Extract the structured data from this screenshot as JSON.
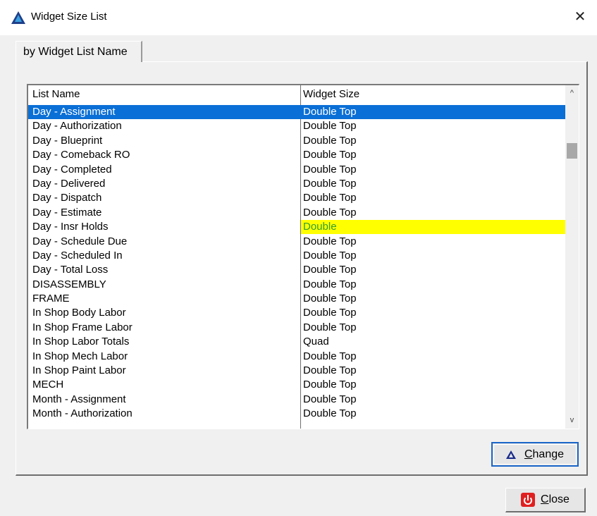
{
  "window": {
    "title": "Widget Size List",
    "close_glyph": "✕"
  },
  "tabs": [
    {
      "label": "by Widget List Name"
    }
  ],
  "list": {
    "headers": {
      "name": "List Name",
      "size": "Widget Size"
    },
    "selected_index": 0,
    "highlight_index": 8,
    "highlight_color": "#ffff00",
    "highlight_text_color": "#2f9e2f",
    "selection_color": "#0a6fd6",
    "rows": [
      {
        "name": "Day - Assignment",
        "size": "Double Top"
      },
      {
        "name": "Day - Authorization",
        "size": "Double Top"
      },
      {
        "name": "Day - Blueprint",
        "size": "Double Top"
      },
      {
        "name": "Day - Comeback RO",
        "size": "Double Top"
      },
      {
        "name": "Day - Completed",
        "size": "Double Top"
      },
      {
        "name": "Day - Delivered",
        "size": "Double Top"
      },
      {
        "name": "Day - Dispatch",
        "size": "Double Top"
      },
      {
        "name": "Day - Estimate",
        "size": "Double Top"
      },
      {
        "name": "Day - Insr Holds",
        "size": "Double"
      },
      {
        "name": "Day - Schedule Due",
        "size": "Double Top"
      },
      {
        "name": "Day - Scheduled In",
        "size": "Double Top"
      },
      {
        "name": "Day - Total Loss",
        "size": "Double Top"
      },
      {
        "name": "DISASSEMBLY",
        "size": "Double Top"
      },
      {
        "name": "FRAME",
        "size": "Double Top"
      },
      {
        "name": "In Shop Body Labor",
        "size": "Double Top"
      },
      {
        "name": "In Shop Frame Labor",
        "size": "Double Top"
      },
      {
        "name": "In Shop Labor Totals",
        "size": "Quad"
      },
      {
        "name": "In Shop Mech Labor",
        "size": "Double Top"
      },
      {
        "name": "In Shop Paint Labor",
        "size": "Double Top"
      },
      {
        "name": "MECH",
        "size": "Double Top"
      },
      {
        "name": "Month - Assignment",
        "size": "Double Top"
      },
      {
        "name": "Month - Authorization",
        "size": "Double Top"
      }
    ],
    "scrollbar": {
      "up_icon": "chevron-up-icon",
      "down_icon": "chevron-down-icon",
      "up_glyph": "^",
      "down_glyph": "v"
    }
  },
  "buttons": {
    "change": {
      "mnemonic": "C",
      "rest": "hange",
      "icon": "triangle-icon"
    },
    "close": {
      "mnemonic": "C",
      "rest": "lose",
      "icon": "power-icon"
    }
  }
}
